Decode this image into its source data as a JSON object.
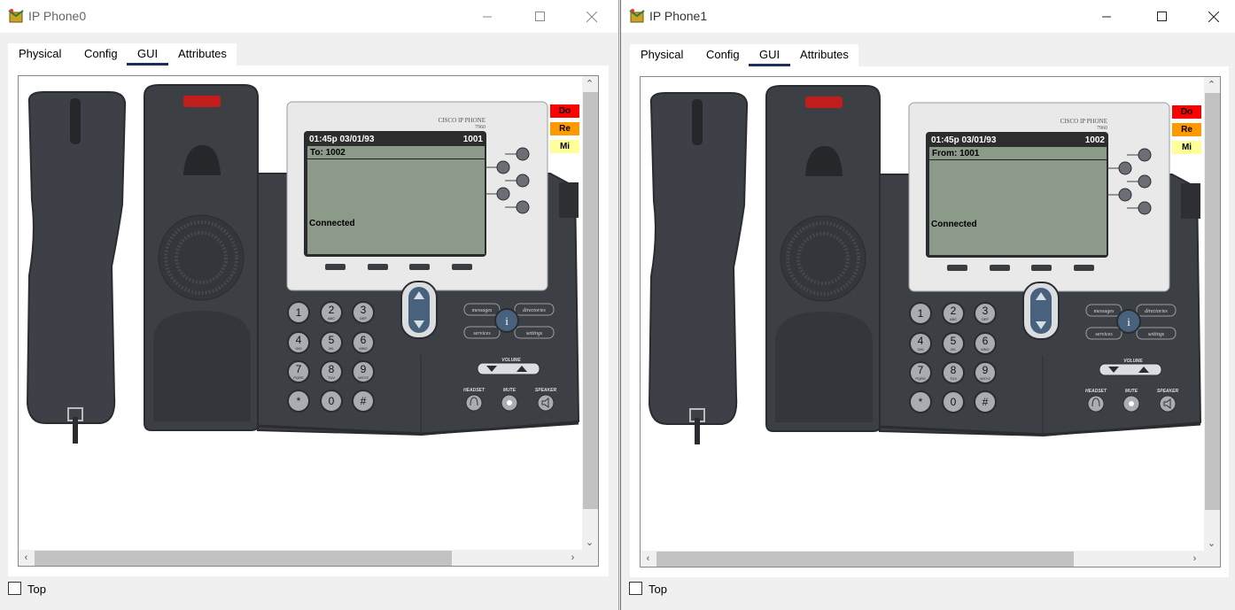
{
  "windows": [
    {
      "title": "IP Phone0",
      "tabs": [
        "Physical",
        "Config",
        "GUI",
        "Attributes"
      ],
      "active_tab": "GUI",
      "phone": {
        "brand": "CISCO IP PHONE",
        "model": "7960",
        "screen": {
          "time_date": "01:45p 03/01/93",
          "extension": "1001",
          "line": "To: 1002",
          "status": "Connected"
        },
        "side_buttons": [
          "Do",
          "Re",
          "Mi"
        ]
      },
      "top_label": "Top"
    },
    {
      "title": "IP Phone1",
      "tabs": [
        "Physical",
        "Config",
        "GUI",
        "Attributes"
      ],
      "active_tab": "GUI",
      "phone": {
        "brand": "CISCO IP PHONE",
        "model": "7960",
        "screen": {
          "time_date": "01:45p 03/01/93",
          "extension": "1002",
          "line": "From: 1001",
          "status": "Connected"
        },
        "side_buttons": [
          "Do",
          "Re",
          "Mi"
        ]
      },
      "top_label": "Top"
    }
  ],
  "keypad": [
    {
      "digit": "1",
      "letters": ""
    },
    {
      "digit": "2",
      "letters": "ABC"
    },
    {
      "digit": "3",
      "letters": "DEF"
    },
    {
      "digit": "4",
      "letters": "GHI"
    },
    {
      "digit": "5",
      "letters": "JKL"
    },
    {
      "digit": "6",
      "letters": "MNO"
    },
    {
      "digit": "7",
      "letters": "PQRS"
    },
    {
      "digit": "8",
      "letters": "TUV"
    },
    {
      "digit": "9",
      "letters": "WXYZ"
    },
    {
      "digit": "*",
      "letters": ""
    },
    {
      "digit": "0",
      "letters": ""
    },
    {
      "digit": "#",
      "letters": ""
    }
  ],
  "function_keys": {
    "messages": "messages",
    "directories": "directories",
    "services": "services",
    "settings": "settings",
    "info": "i"
  },
  "labels": {
    "volume": "VOLUME",
    "headset": "HEADSET",
    "mute": "MUTE",
    "speaker": "SPEAKER"
  },
  "colors": {
    "do": "#ff0000",
    "re": "#ff9900",
    "mi": "#ffff99",
    "lcd": "#8c9a8a",
    "phone_body": "#3c3f44",
    "tab_underline": "#1a2f5e"
  }
}
